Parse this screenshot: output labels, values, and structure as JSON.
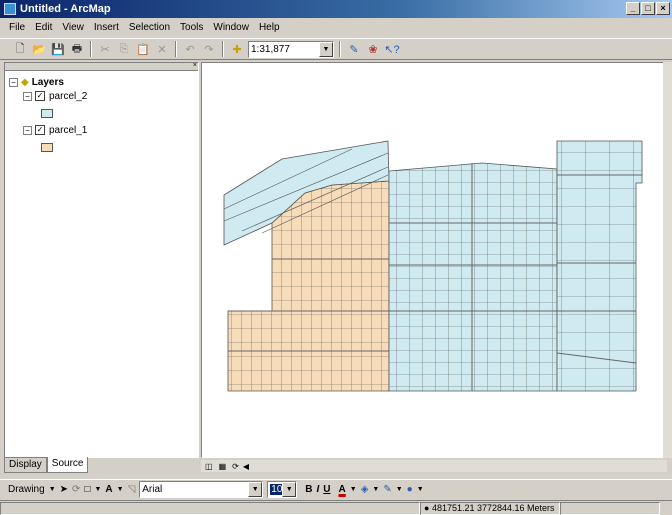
{
  "window": {
    "title": "Untitled - ArcMap"
  },
  "menu": [
    "File",
    "Edit",
    "View",
    "Insert",
    "Selection",
    "Tools",
    "Window",
    "Help"
  ],
  "toolbar": {
    "scale": "1:31,877"
  },
  "toc": {
    "root_label": "Layers",
    "layers": [
      {
        "label": "parcel_2",
        "visible": true,
        "color": "#cfeaf0"
      },
      {
        "label": "parcel_1",
        "visible": true,
        "color": "#f6dcb8"
      }
    ],
    "tabs": [
      "Display",
      "Source"
    ],
    "active_tab": "Source"
  },
  "drawing": {
    "label": "Drawing",
    "font": "Arial",
    "size": "10",
    "bold": "B",
    "italic": "I",
    "underline": "U"
  },
  "status": {
    "coords": "481751.21 3772844.16 Meters"
  },
  "colors": {
    "parcel_2": "#cfeaf0",
    "parcel_1": "#f6dcb8",
    "title_start": "#0a246a"
  }
}
